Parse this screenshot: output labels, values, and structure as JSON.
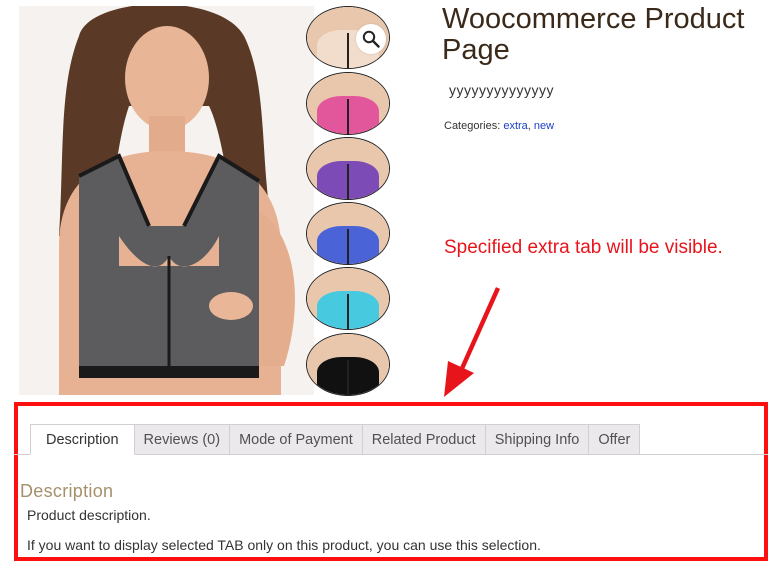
{
  "product": {
    "title": "Woocommerce Product Page",
    "price": "yyyyyyyyyyyyyy",
    "categories_label": "Categories:",
    "categories": [
      "extra",
      "new"
    ],
    "category_separator": ","
  },
  "gallery": {
    "thumbnail_colors": [
      "#f2dccb",
      "#e2579b",
      "#7d4bb5",
      "#4a64d8",
      "#47c9e0",
      "#111111"
    ]
  },
  "annotation": {
    "text": "Specified extra tab will be visible.",
    "color": "#e8141c"
  },
  "tabs": [
    {
      "label": "Description",
      "active": true
    },
    {
      "label": "Reviews (0)",
      "active": false
    },
    {
      "label": "Mode of Payment",
      "active": false
    },
    {
      "label": "Related Product",
      "active": false
    },
    {
      "label": "Shipping Info",
      "active": false
    },
    {
      "label": "Offer",
      "active": false
    }
  ],
  "panel": {
    "heading": "Description",
    "paragraphs": [
      "Product description.",
      "If you want to display selected TAB only on this product, you can use this selection."
    ]
  },
  "colors": {
    "highlight": "#ff1010",
    "link": "#1e40c7",
    "heading": "#a6906b"
  }
}
